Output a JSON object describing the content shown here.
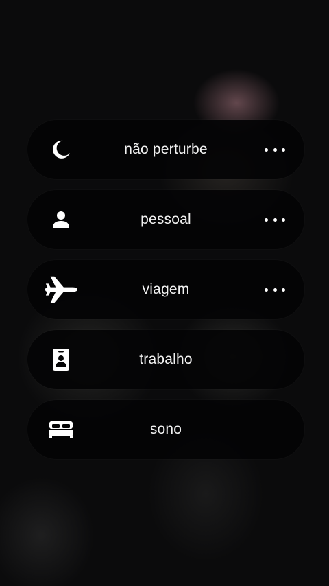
{
  "modes": [
    {
      "label": "não perturbe",
      "icon": "moon-icon",
      "has_more": true
    },
    {
      "label": "pessoal",
      "icon": "person-icon",
      "has_more": true
    },
    {
      "label": "viagem",
      "icon": "airplane-icon",
      "has_more": true
    },
    {
      "label": "trabalho",
      "icon": "id-badge-icon",
      "has_more": false
    },
    {
      "label": "sono",
      "icon": "bed-icon",
      "has_more": false
    }
  ]
}
